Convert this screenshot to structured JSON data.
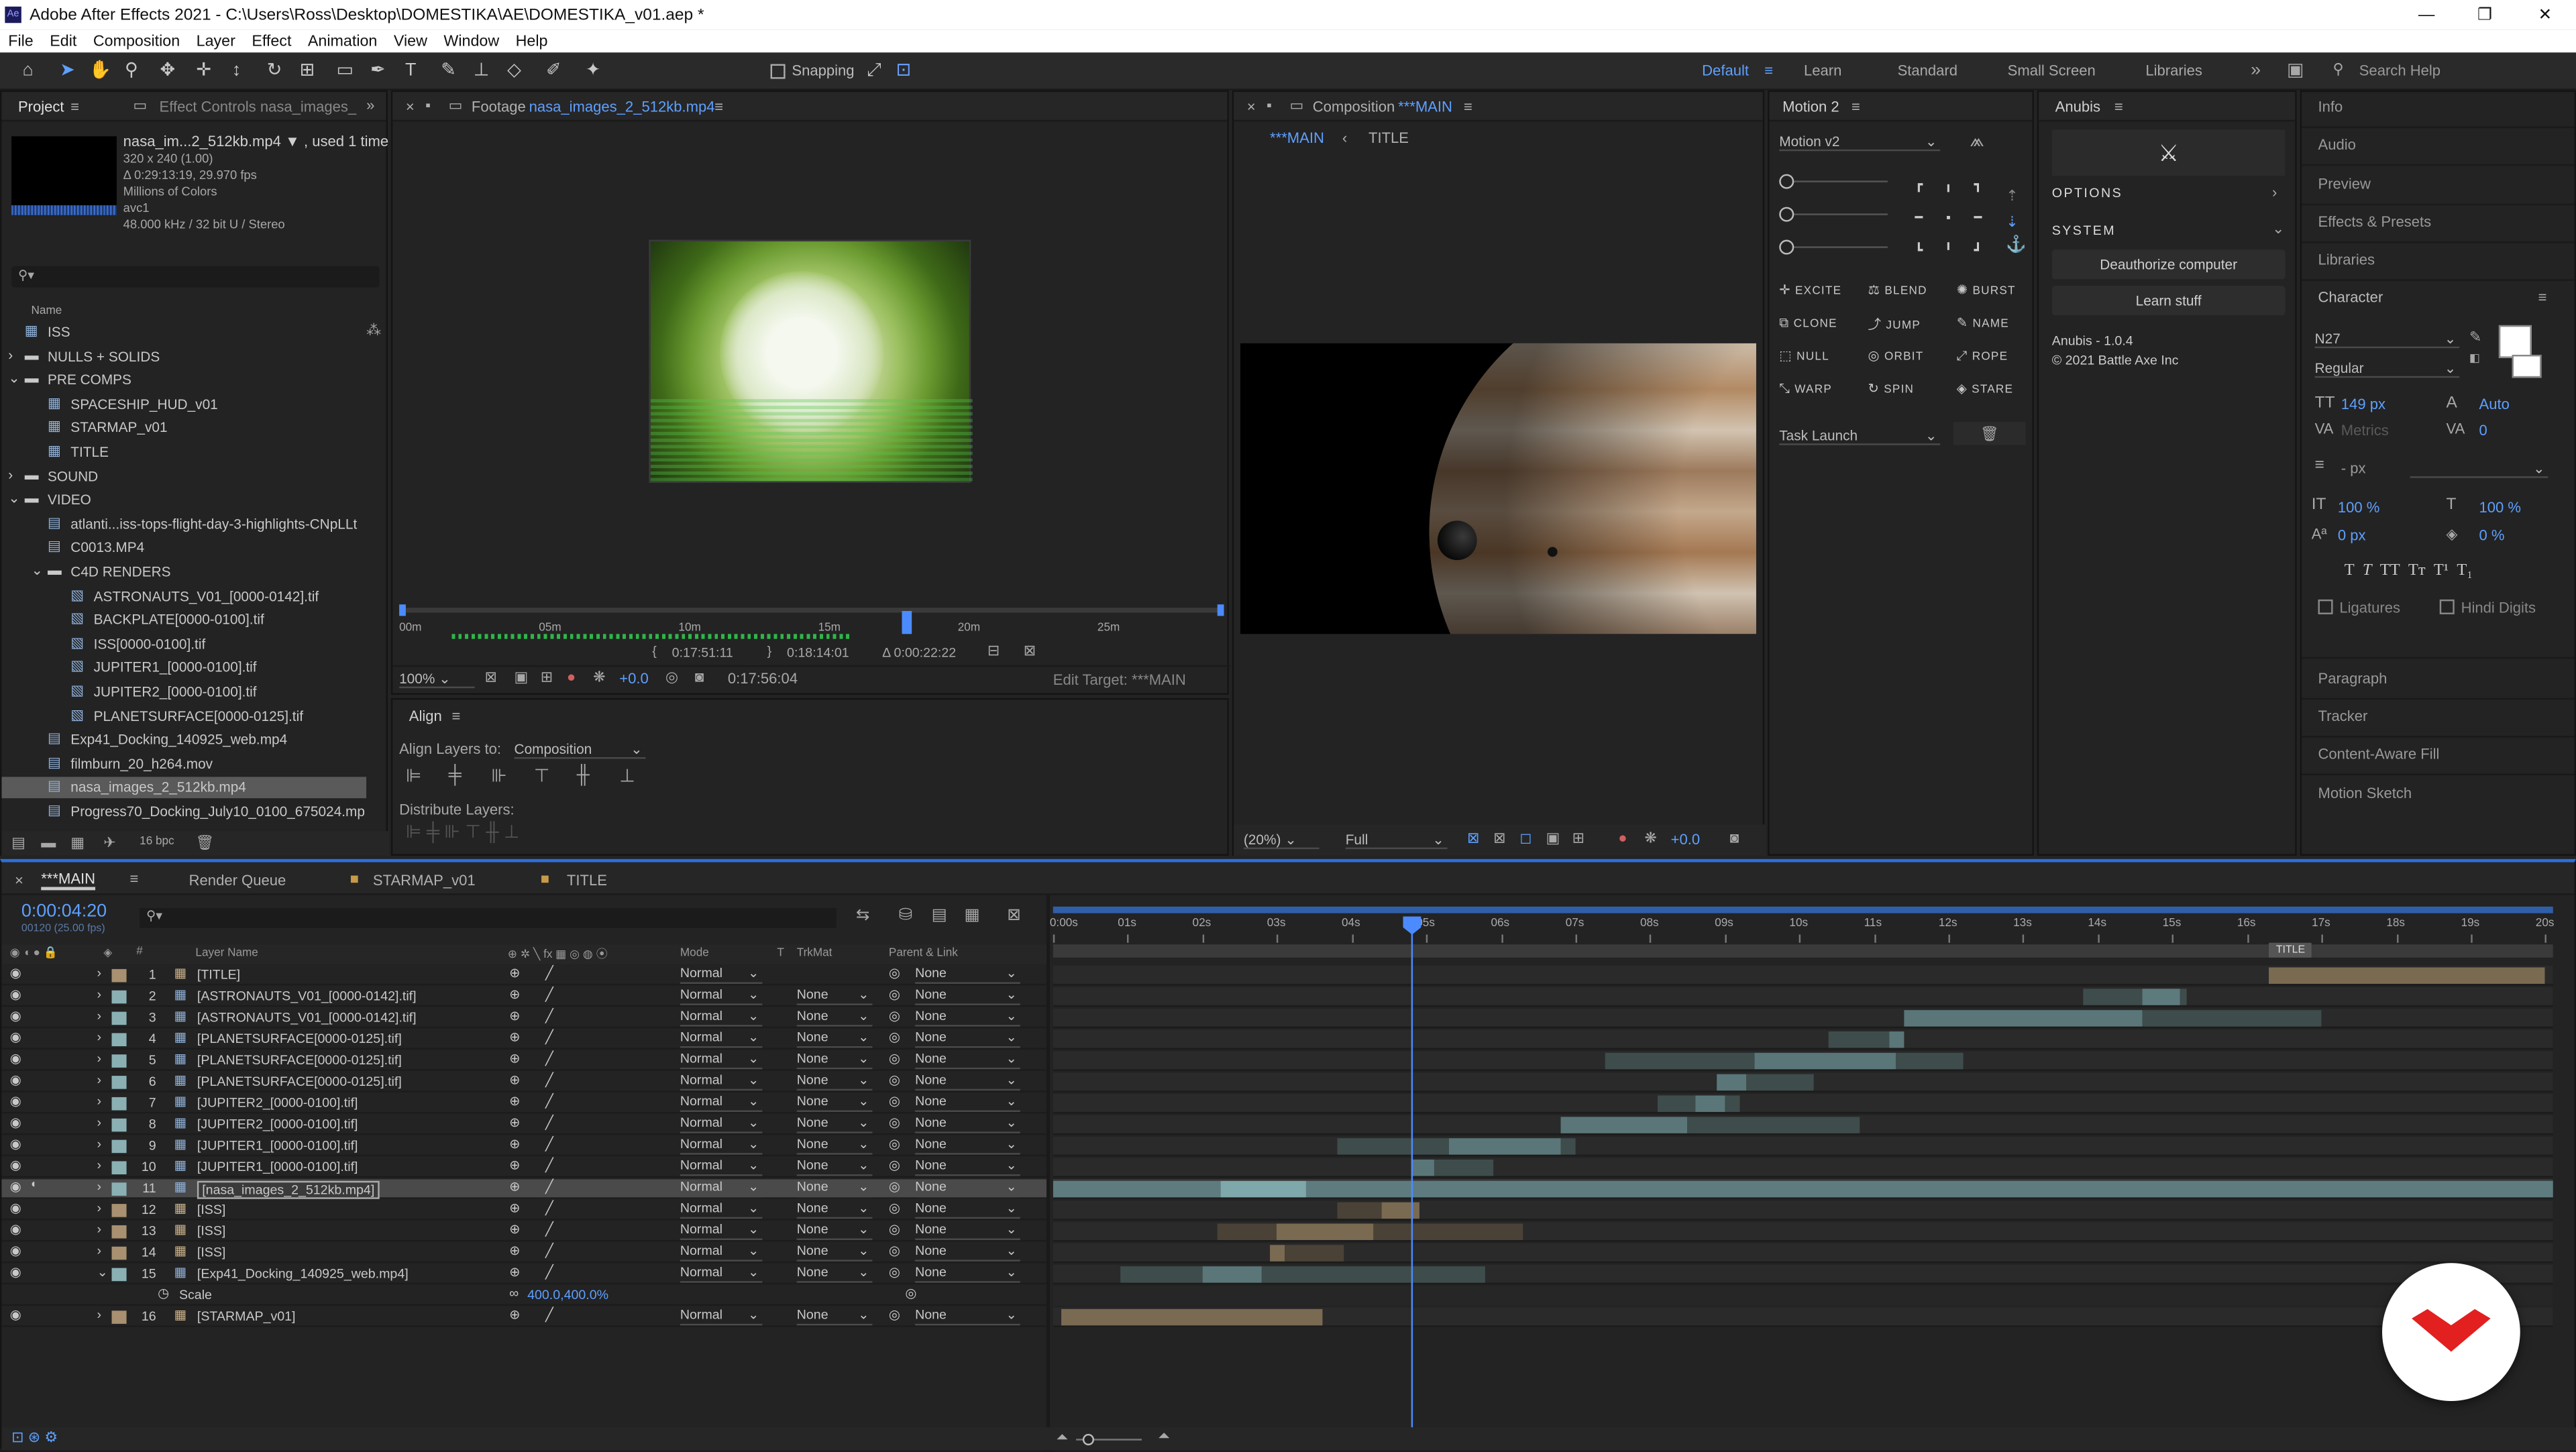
{
  "app": {
    "title": "Adobe After Effects 2021 - C:\\Users\\Ross\\Desktop\\DOMESTIKA\\AE\\DOMESTIKA_v01.aep *",
    "min": "—",
    "max": "❐",
    "close": "✕"
  },
  "menu": [
    "File",
    "Edit",
    "Composition",
    "Layer",
    "Effect",
    "Animation",
    "View",
    "Window",
    "Help"
  ],
  "toolbar": {
    "snapping": "Snapping",
    "workspaces": [
      "Default",
      "Learn",
      "Standard",
      "Small Screen",
      "Libraries"
    ],
    "more": "»",
    "search_placeholder": "Search Help"
  },
  "project": {
    "tab": "Project",
    "tab2": "Effect Controls nasa_images_",
    "file_name": "nasa_im...2_512kb.mp4 ▼ , used 1 time",
    "info": [
      "320 x 240 (1.00)",
      "Δ 0:29:13:19, 29.970 fps",
      "Millions of Colors",
      "avc1",
      "48.000 kHz / 32 bit U / Stereo"
    ],
    "name_col": "Name",
    "bpc": "16 bpc",
    "items": [
      {
        "label": "ISS",
        "level": 0,
        "kind": "comp"
      },
      {
        "label": "NULLS + SOLIDS",
        "level": 0,
        "kind": "folder",
        "caret": "›"
      },
      {
        "label": "PRE COMPS",
        "level": 0,
        "kind": "folder",
        "caret": "⌄"
      },
      {
        "label": "SPACESHIP_HUD_v01",
        "level": 1,
        "kind": "comp"
      },
      {
        "label": "STARMAP_v01",
        "level": 1,
        "kind": "comp"
      },
      {
        "label": "TITLE",
        "level": 1,
        "kind": "comp"
      },
      {
        "label": "SOUND",
        "level": 0,
        "kind": "folder",
        "caret": "›"
      },
      {
        "label": "VIDEO",
        "level": 0,
        "kind": "folder",
        "caret": "⌄"
      },
      {
        "label": "atlanti...iss-tops-flight-day-3-highlights-CNpLLt",
        "level": 1,
        "kind": "file"
      },
      {
        "label": "C0013.MP4",
        "level": 1,
        "kind": "file"
      },
      {
        "label": "C4D RENDERS",
        "level": 1,
        "kind": "folder",
        "caret": "⌄"
      },
      {
        "label": "ASTRONAUTS_V01_[0000-0142].tif",
        "level": 2,
        "kind": "seq"
      },
      {
        "label": "BACKPLATE[0000-0100].tif",
        "level": 2,
        "kind": "seq"
      },
      {
        "label": "ISS[0000-0100].tif",
        "level": 2,
        "kind": "seq"
      },
      {
        "label": "JUPITER1_[0000-0100].tif",
        "level": 2,
        "kind": "seq"
      },
      {
        "label": "JUPITER2_[0000-0100].tif",
        "level": 2,
        "kind": "seq"
      },
      {
        "label": "PLANETSURFACE[0000-0125].tif",
        "level": 2,
        "kind": "seq"
      },
      {
        "label": "Exp41_Docking_140925_web.mp4",
        "level": 1,
        "kind": "file"
      },
      {
        "label": "filmburn_20_h264.mov",
        "level": 1,
        "kind": "file"
      },
      {
        "label": "nasa_images_2_512kb.mp4",
        "level": 1,
        "kind": "file",
        "selected": true
      },
      {
        "label": "Progress70_Docking_July10_0100_675024.mp",
        "level": 1,
        "kind": "file"
      }
    ]
  },
  "footage": {
    "tab_prefix": "Footage",
    "tab_name": "nasa_images_2_512kb.mp4",
    "ruler": [
      "00m",
      "05m",
      "10m",
      "15m",
      "20m",
      "25m"
    ],
    "in": "0:17:51:11",
    "out": "0:18:14:01",
    "dur": "Δ 0:00:22:22",
    "zoom": "100%",
    "exposure": "+0.0",
    "time": "0:17:56:04",
    "edit_target": "Edit Target: ***MAIN",
    "playhead_frac": 0.616
  },
  "align": {
    "tab": "Align",
    "align_to_label": "Align Layers to:",
    "align_to": "Composition",
    "distribute": "Distribute Layers:"
  },
  "comp": {
    "tab_prefix": "Composition",
    "tab_name": "***MAIN",
    "crumbs": [
      "***MAIN",
      "TITLE"
    ],
    "zoom": "(20%)",
    "res": "Full",
    "exposure": "+0.0"
  },
  "motion": {
    "tab": "Motion 2",
    "preset": "Motion v2",
    "buttons": [
      "EXCITE",
      "BLEND",
      "BURST",
      "CLONE",
      "JUMP",
      "NAME",
      "NULL",
      "ORBIT",
      "ROPE",
      "WARP",
      "SPIN",
      "STARE"
    ],
    "task": "Task Launch"
  },
  "anubis": {
    "tab": "Anubis",
    "options": "OPTIONS",
    "system": "SYSTEM",
    "deauth": "Deauthorize computer",
    "learn": "Learn stuff",
    "version": "Anubis - 1.0.4",
    "copyright": "© 2021 Battle Axe Inc"
  },
  "right": {
    "items": [
      "Info",
      "Audio",
      "Preview",
      "Effects & Presets",
      "Libraries"
    ],
    "character": "Character",
    "font": "N27",
    "style": "Regular",
    "size": "149 px",
    "leading": "Auto",
    "kerning": "Metrics",
    "tracking": "0",
    "stroke": "- px",
    "vscale": "100 %",
    "hscale": "100 %",
    "baseline": "0 px",
    "tsume": "0 %",
    "ligatures": "Ligatures",
    "hindi": "Hindi Digits",
    "more": [
      "Paragraph",
      "Tracker",
      "Content-Aware Fill",
      "Motion Sketch"
    ]
  },
  "timeline": {
    "tabs": [
      "***MAIN",
      "Render Queue",
      "STARMAP_v01",
      "TITLE"
    ],
    "timecode": "0:00:04:20",
    "timecode_sub": "00120 (25.00 fps)",
    "cols": {
      "layer_name": "Layer Name",
      "mode": "Mode",
      "t": "T",
      "trkmat": "TrkMat",
      "parent": "Parent & Link"
    },
    "ruler": [
      "0:00s",
      "01s",
      "02s",
      "03s",
      "04s",
      "05s",
      "06s",
      "07s",
      "08s",
      "09s",
      "10s",
      "11s",
      "12s",
      "13s",
      "14s",
      "15s",
      "16s",
      "17s",
      "18s",
      "19s",
      "20s"
    ],
    "title_marker": "TITLE",
    "playhead_sec": 4.8,
    "total_sec": 20,
    "layers": [
      {
        "n": "1",
        "name": "[TITLE]",
        "color": "#a89070",
        "mode": "Normal",
        "trk": "",
        "parent": "None",
        "bars": [
          [
            16.3,
            20,
            "#7a6a52"
          ]
        ]
      },
      {
        "n": "2",
        "name": "[ASTRONAUTS_V01_[0000-0142].tif]",
        "color": "#8ab0b4",
        "mode": "Normal",
        "trk": "None",
        "parent": "None",
        "bars": [
          [
            13.8,
            14.6,
            "#3e4c4c"
          ],
          [
            14.6,
            15.1,
            "#5d7a7c"
          ],
          [
            15.1,
            15.2,
            "#3e4c4c"
          ]
        ]
      },
      {
        "n": "3",
        "name": "[ASTRONAUTS_V01_[0000-0142].tif]",
        "color": "#8ab0b4",
        "mode": "Normal",
        "trk": "None",
        "parent": "None",
        "bars": [
          [
            11.4,
            14.6,
            "#5a7678"
          ],
          [
            14.6,
            17.0,
            "#3e4c4c"
          ]
        ]
      },
      {
        "n": "4",
        "name": "[PLANETSURFACE[0000-0125].tif]",
        "color": "#8ab0b4",
        "mode": "Normal",
        "trk": "None",
        "parent": "None",
        "bars": [
          [
            10.4,
            11.2,
            "#3e4c4c"
          ],
          [
            11.2,
            11.4,
            "#5a7678"
          ]
        ]
      },
      {
        "n": "5",
        "name": "[PLANETSURFACE[0000-0125].tif]",
        "color": "#8ab0b4",
        "mode": "Normal",
        "trk": "None",
        "parent": "None",
        "bars": [
          [
            7.4,
            9.4,
            "#3e4c4c"
          ],
          [
            9.4,
            11.3,
            "#5a7678"
          ],
          [
            11.3,
            12.2,
            "#3e4c4c"
          ]
        ]
      },
      {
        "n": "6",
        "name": "[PLANETSURFACE[0000-0125].tif]",
        "color": "#8ab0b4",
        "mode": "Normal",
        "trk": "None",
        "parent": "None",
        "bars": [
          [
            8.9,
            9.3,
            "#5a7678"
          ],
          [
            9.3,
            10.2,
            "#3e4c4c"
          ]
        ]
      },
      {
        "n": "7",
        "name": "[JUPITER2_[0000-0100].tif]",
        "color": "#8ab0b4",
        "mode": "Normal",
        "trk": "None",
        "parent": "None",
        "bars": [
          [
            8.1,
            8.6,
            "#3e4c4c"
          ],
          [
            8.6,
            9.0,
            "#5a7678"
          ],
          [
            9.0,
            9.2,
            "#3e4c4c"
          ]
        ]
      },
      {
        "n": "8",
        "name": "[JUPITER2_[0000-0100].tif]",
        "color": "#8ab0b4",
        "mode": "Normal",
        "trk": "None",
        "parent": "None",
        "bars": [
          [
            6.8,
            8.5,
            "#5a7678"
          ],
          [
            8.5,
            10.8,
            "#3e4c4c"
          ]
        ]
      },
      {
        "n": "9",
        "name": "[JUPITER1_[0000-0100].tif]",
        "color": "#8ab0b4",
        "mode": "Normal",
        "trk": "None",
        "parent": "None",
        "bars": [
          [
            3.8,
            5.3,
            "#3e4c4c"
          ],
          [
            5.3,
            6.8,
            "#5a7678"
          ],
          [
            6.8,
            7.0,
            "#3e4c4c"
          ]
        ]
      },
      {
        "n": "10",
        "name": "[JUPITER1_[0000-0100].tif]",
        "color": "#8ab0b4",
        "mode": "Normal",
        "trk": "None",
        "parent": "None",
        "bars": [
          [
            4.8,
            5.1,
            "#5a7678"
          ],
          [
            5.1,
            5.9,
            "#3e4c4c"
          ]
        ]
      },
      {
        "n": "11",
        "name": "[nasa_images_2_512kb.mp4]",
        "color": "#8ab0b4",
        "mode": "Normal",
        "trk": "None",
        "parent": "None",
        "selected": true,
        "bars": [
          [
            0,
            2.25,
            "#5e7c80"
          ],
          [
            2.25,
            3.4,
            "#7fa8ac"
          ],
          [
            3.4,
            20.2,
            "#5e7c80"
          ]
        ]
      },
      {
        "n": "12",
        "name": "[ISS]",
        "color": "#a89070",
        "mode": "Normal",
        "trk": "None",
        "parent": "None",
        "bars": [
          [
            3.8,
            4.4,
            "#4a4236"
          ],
          [
            4.4,
            4.9,
            "#7a6a52"
          ]
        ]
      },
      {
        "n": "13",
        "name": "[ISS]",
        "color": "#a89070",
        "mode": "Normal",
        "trk": "None",
        "parent": "None",
        "bars": [
          [
            2.2,
            3.0,
            "#4a4236"
          ],
          [
            3.0,
            4.3,
            "#7a6a52"
          ],
          [
            4.3,
            6.3,
            "#4a4236"
          ]
        ]
      },
      {
        "n": "14",
        "name": "[ISS]",
        "color": "#a89070",
        "mode": "Normal",
        "trk": "None",
        "parent": "None",
        "bars": [
          [
            2.9,
            3.1,
            "#7a6a52"
          ],
          [
            3.1,
            3.9,
            "#4a4236"
          ]
        ]
      },
      {
        "n": "15",
        "name": "[Exp41_Docking_140925_web.mp4]",
        "color": "#8ab0b4",
        "mode": "Normal",
        "trk": "None",
        "parent": "None",
        "expanded": true,
        "bars": [
          [
            0.9,
            2.0,
            "#3e4c4c"
          ],
          [
            2.0,
            2.8,
            "#5a7678"
          ],
          [
            2.8,
            5.8,
            "#3e4c4c"
          ]
        ]
      },
      {
        "n": "16",
        "name": "[STARMAP_v01]",
        "color": "#a89070",
        "mode": "Normal",
        "trk": "None",
        "parent": "None",
        "bars": [
          [
            0.1,
            3.6,
            "#7a6a52"
          ]
        ]
      }
    ],
    "scale_label": "Scale",
    "scale_value": "400.0,400.0%"
  }
}
